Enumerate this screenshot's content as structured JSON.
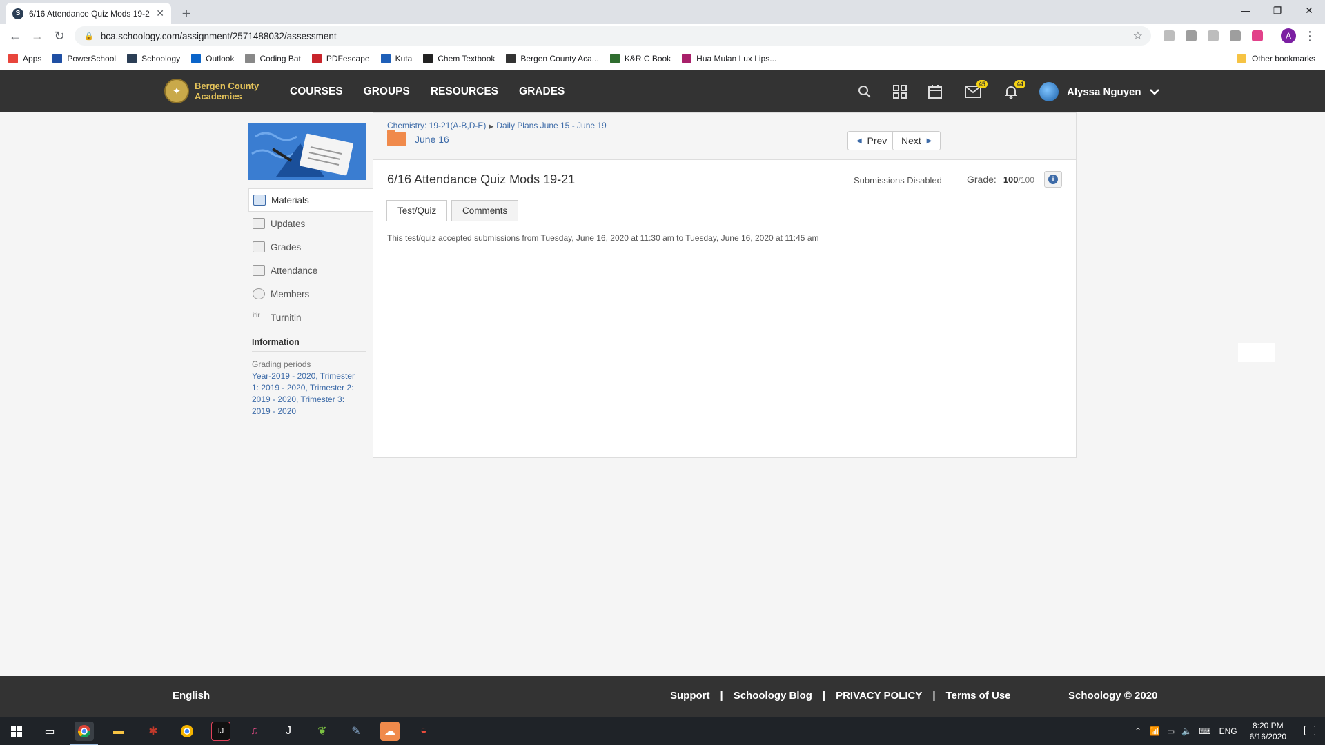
{
  "browser": {
    "tab_title": "6/16 Attendance Quiz Mods 19-2",
    "tab_favicon": "S",
    "url": "bca.schoology.com/assignment/2571488032/assessment",
    "profile_initial": "A",
    "bookmarks": [
      {
        "label": "Apps",
        "icon": "apps-grid-icon",
        "color": "#e8453c"
      },
      {
        "label": "PowerSchool",
        "icon": "powerschool-icon",
        "color": "#1f4fa3"
      },
      {
        "label": "Schoology",
        "icon": "schoology-icon",
        "color": "#2b3e55"
      },
      {
        "label": "Outlook",
        "icon": "outlook-icon",
        "color": "#0a64c9"
      },
      {
        "label": "Coding Bat",
        "icon": "globe-icon",
        "color": "#888888"
      },
      {
        "label": "PDFescape",
        "icon": "pdfescape-icon",
        "color": "#c8242b"
      },
      {
        "label": "Kuta",
        "icon": "kuta-icon",
        "color": "#1e5fb8"
      },
      {
        "label": "Chem Textbook",
        "icon": "textbook-a-icon",
        "color": "#222222"
      },
      {
        "label": "Bergen County Aca...",
        "icon": "bca-icon",
        "color": "#333333"
      },
      {
        "label": "K&R C Book",
        "icon": "cs-icon",
        "color": "#2f6d2f"
      },
      {
        "label": "Hua Mulan Lux Lips...",
        "icon": "lips-icon",
        "color": "#a8206a"
      }
    ],
    "other_bookmarks": "Other bookmarks"
  },
  "header": {
    "logo_text": "Bergen County Academies",
    "nav": [
      "COURSES",
      "GROUPS",
      "RESOURCES",
      "GRADES"
    ],
    "messages_badge": "45",
    "notifications_badge": "44",
    "user_name": "Alyssa Nguyen"
  },
  "sidebar": {
    "items": [
      {
        "label": "Materials",
        "icon": "materials-icon"
      },
      {
        "label": "Updates",
        "icon": "updates-icon"
      },
      {
        "label": "Grades",
        "icon": "grades-icon"
      },
      {
        "label": "Attendance",
        "icon": "attendance-icon"
      },
      {
        "label": "Members",
        "icon": "members-icon"
      },
      {
        "label": "Turnitin",
        "icon": "turnitin-icon"
      }
    ],
    "info_title": "Information",
    "grading_label": "Grading periods",
    "grading_value": "Year-2019 - 2020, Trimester 1: 2019 - 2020, Trimester 2: 2019 - 2020, Trimester 3: 2019 - 2020"
  },
  "main": {
    "breadcrumb": [
      "Chemistry: 19-21(A-B,D-E)",
      "Daily Plans June 15 - June 19"
    ],
    "folder_name": "June 16",
    "prev_label": "Prev",
    "next_label": "Next",
    "title": "6/16 Attendance Quiz Mods 19-21",
    "submissions_status": "Submissions Disabled",
    "grade_label": "Grade:",
    "grade_value": "100",
    "grade_max": "/100",
    "tabs": [
      "Test/Quiz",
      "Comments"
    ],
    "quiz_note": "This test/quiz accepted submissions from Tuesday, June 16, 2020 at 11:30 am to Tuesday, June 16, 2020 at 11:45 am"
  },
  "footer": {
    "language": "English",
    "links": [
      "Support",
      "Schoology Blog",
      "PRIVACY POLICY",
      "Terms of Use"
    ],
    "separator": "|",
    "copyright": "Schoology © 2020"
  },
  "taskbar": {
    "lang": "ENG",
    "time": "8:20 PM",
    "date": "6/16/2020"
  }
}
